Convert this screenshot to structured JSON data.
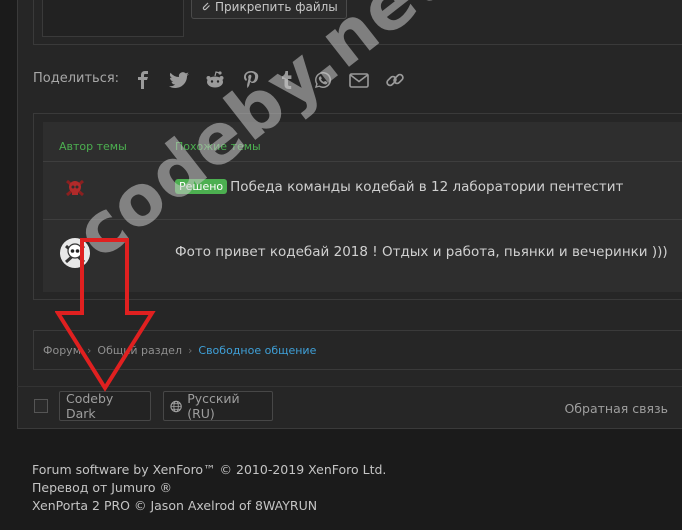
{
  "editor": {
    "attach_label": "Прикрепить файлы"
  },
  "share": {
    "label": "Поделиться:",
    "icons": [
      "facebook-icon",
      "twitter-icon",
      "reddit-icon",
      "pinterest-icon",
      "tumblr-icon",
      "whatsapp-icon",
      "email-icon",
      "link-icon"
    ]
  },
  "info": {
    "col_author": "Автор темы",
    "col_similar": "Похожие темы",
    "threads": [
      {
        "badge": "Решено",
        "title": "Победа команды кодебай в 12 лаборатории пентестит"
      },
      {
        "badge": "",
        "title": "Фото привет кодебай 2018 ! Отдых и работа, пьянки и вечеринки )))"
      }
    ]
  },
  "breadcrumb": {
    "items": [
      "Форум",
      "Общий раздел",
      "Свободное общение"
    ]
  },
  "footer": {
    "style_label": "Codeby Dark",
    "language_label": "Русский (RU)",
    "feedback_label": "Обратная связь"
  },
  "copyright": {
    "line1": "Forum software by XenForo™ © 2010-2019 XenForo Ltd.",
    "line2": "Перевод от Jumuro ®",
    "line3": "XenPorta 2 PRO © Jason Axelrod of 8WAYRUN"
  },
  "watermark": "codeby.net",
  "colors": {
    "accent_green": "#4caf50",
    "link_blue": "#3fa0d8",
    "arrow_red": "#e02020"
  }
}
